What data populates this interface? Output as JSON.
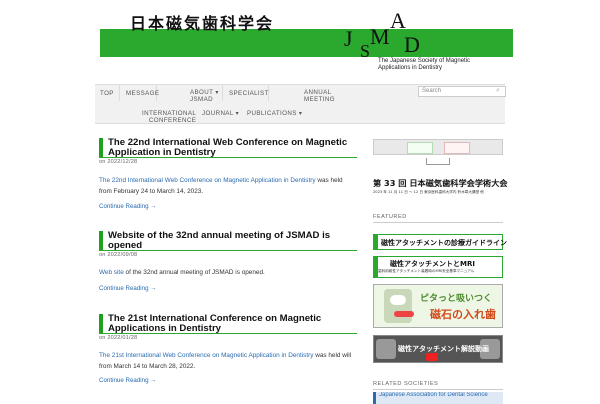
{
  "banner": {
    "jp_title": "日本磁気歯科学会",
    "logo_letters": [
      "J",
      "S",
      "M",
      "A",
      "D"
    ],
    "subtitle_line1": "The Japanese Society of Magnetic",
    "subtitle_line2": "Applications in Dentistry",
    "stripe_color": "#2aa92e"
  },
  "nav": {
    "items": [
      {
        "label": "TOP"
      },
      {
        "label": "MESSAGE"
      },
      {
        "label_line1": "ABOUT ▾",
        "label_line2": "JSMAD"
      },
      {
        "label": "SPECIALIST"
      },
      {
        "label_line1": "ANNUAL",
        "label_line2": "MEETING"
      },
      {
        "label_line1": "INTERNATIONAL",
        "label_line2": "CONFERENCE"
      },
      {
        "label": "JOURNAL ▾"
      },
      {
        "label": "PUBLICATIONS ▾"
      }
    ],
    "search_placeholder": "Search"
  },
  "posts": [
    {
      "title": "The 22nd International Web Conference on Magnetic Application in Dentistry",
      "date": "on 2022/12/28",
      "link_text": "The 22nd International Web Conference on Magnetic Application in Dentistry",
      "body_after": " was held from February 24 to March 14, 2023.",
      "more": "Continue Reading →"
    },
    {
      "title": "Website of the 32nd annual meeting of JSMAD is opened",
      "date": "on 2022/09/08",
      "link_text": "Web site",
      "body_after": " of the 32nd annual meeting of JSMAD is opened.",
      "more": "Continue Reading →"
    },
    {
      "title": "The 21st International Conference on Magnetic Applications in Dentistry",
      "date": "on 2022/01/28",
      "link_text": "The 21st International Web Conference on Magnetic Application in Dentistry",
      "body_after": " was held will from March 14 to March 28, 2022.",
      "more": "Continue Reading →"
    }
  ],
  "sidebar": {
    "meeting_banner": {
      "title": "第 33 回 日本磁気歯科学会学術大会",
      "subtitle": "2023 年 11 月 11 日 ～ 12 日  東京医科歯科大学内 鈴木章大講堂 他"
    },
    "featured_heading": "FEATURED",
    "featured": [
      {
        "text": "磁性アタッチメントの診療ガイドライン"
      },
      {
        "text": "磁性アタッチメントとMRI",
        "sub": "歯科用磁性アタッチメント装着時のMRI安全基準マニュアル"
      },
      {
        "text": "ピタっと吸いつく",
        "text2": "磁石の入れ歯"
      },
      {
        "text": "磁性アタッチメント解説動画"
      }
    ],
    "related_heading": "RELATED SOCIETIES",
    "related": [
      {
        "text": "Japanese Association for Dental Science"
      }
    ]
  }
}
